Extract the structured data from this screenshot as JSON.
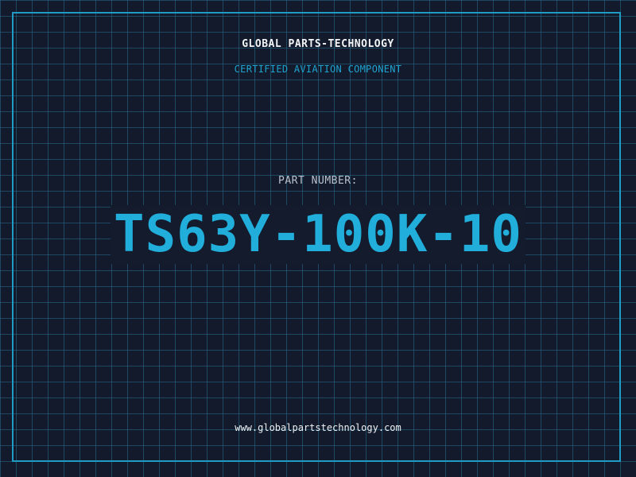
{
  "header": {
    "brand": "GLOBAL PARTS-TECHNOLOGY",
    "tagline": "CERTIFIED AVIATION COMPONENT"
  },
  "part": {
    "label": "PART NUMBER:",
    "number": "TS63Y-100K-10"
  },
  "footer": {
    "website": "www.globalpartstechnology.com"
  },
  "colors": {
    "background": "#121a2c",
    "grid": "#286e8c",
    "frame": "#1f9bc4",
    "accent": "#21aedb",
    "text": "#f2f4f6"
  }
}
